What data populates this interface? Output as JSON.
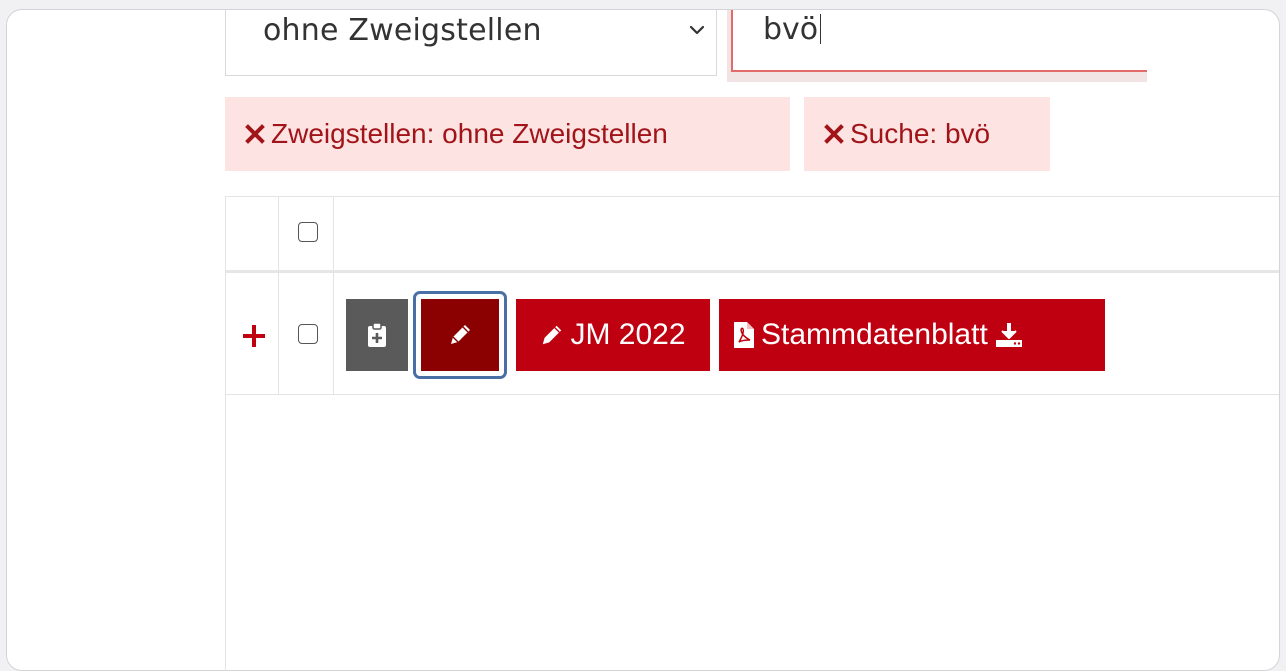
{
  "filters": {
    "branch_select_value": "ohne Zweigstellen",
    "search_value": "bvö"
  },
  "active_filters": [
    {
      "label": "Zweigstellen: ohne Zweigstellen"
    },
    {
      "label": "Suche: bvö"
    }
  ],
  "row": {
    "actions": {
      "jm_label": "JM 2022",
      "stammdaten_label": "Stammdatenblatt"
    }
  },
  "colors": {
    "chip_bg": "#fde3e1",
    "chip_text": "#a1141a",
    "action_red": "#bf0010",
    "edit_dark_red": "#8b0000",
    "grey_button": "#5a5a5a",
    "focus_ring": "#4a6fa5"
  },
  "icons": [
    "chevron-down-icon",
    "remove-x-icon",
    "plus-icon",
    "clipboard-plus-icon",
    "pencil-icon",
    "pdf-file-icon",
    "download-icon"
  ]
}
